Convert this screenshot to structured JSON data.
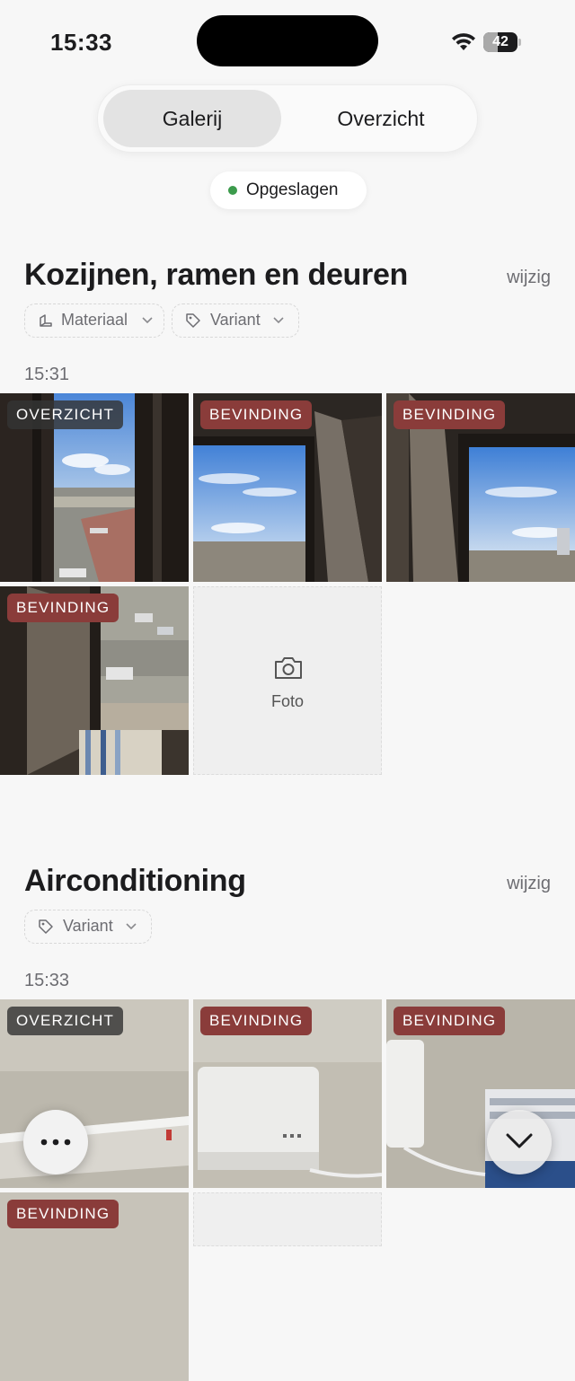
{
  "status": {
    "time": "15:33",
    "battery": "42",
    "battery_level": 0.42
  },
  "tabs": {
    "gallery": "Galerij",
    "overview": "Overzicht",
    "active": "gallery"
  },
  "save_status": "Opgeslagen",
  "sections": [
    {
      "title": "Kozijnen, ramen en deuren",
      "edit": "wijzig",
      "chips": [
        "Materiaal",
        "Variant"
      ],
      "time": "15:31",
      "photos": [
        {
          "badge": "OVERZICHT"
        },
        {
          "badge": "BEVINDING"
        },
        {
          "badge": "BEVINDING"
        },
        {
          "badge": "BEVINDING"
        }
      ],
      "add_photo": "Foto"
    },
    {
      "title": "Airconditioning",
      "edit": "wijzig",
      "chips": [
        "Variant"
      ],
      "time": "15:33",
      "photos": [
        {
          "badge": "OVERZICHT"
        },
        {
          "badge": "BEVINDING"
        },
        {
          "badge": "BEVINDING"
        },
        {
          "badge": "BEVINDING"
        }
      ]
    }
  ],
  "colors": {
    "badge_overzicht": "#343434",
    "badge_bevinding": "#8a3c3a",
    "saved_dot": "#3c9b4c"
  },
  "icons": {
    "more": "ellipsis-icon",
    "scroll_down": "chevron-down-icon",
    "camera": "camera-icon"
  }
}
